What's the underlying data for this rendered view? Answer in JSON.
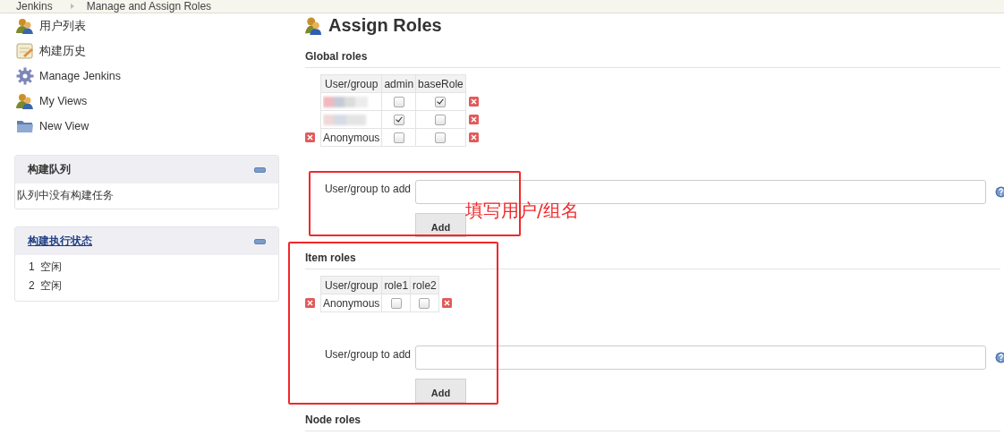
{
  "breadcrumb": [
    {
      "label": "Jenkins"
    },
    {
      "label": "Manage and Assign Roles"
    }
  ],
  "sidebar": {
    "tasks": [
      {
        "label": "用户列表"
      },
      {
        "label": "构建历史"
      },
      {
        "label": "Manage Jenkins"
      },
      {
        "label": "My Views"
      },
      {
        "label": "New View"
      }
    ],
    "build_queue": {
      "title": "构建队列",
      "expanded": true,
      "message": "队列中没有构建任务"
    },
    "executors": {
      "title": "构建执行状态",
      "expanded": true,
      "items": [
        {
          "number": "1",
          "status": "空闲"
        },
        {
          "number": "2",
          "status": "空闲"
        }
      ]
    }
  },
  "page": {
    "title": "Assign Roles",
    "sections": [
      {
        "title": "Global roles",
        "columns": [
          "User/group",
          "admin",
          "baseRole"
        ],
        "rows": [
          {
            "kind": "blurred",
            "checked": [
              false,
              true
            ]
          },
          {
            "kind": "blurred",
            "checked": [
              true,
              false
            ]
          },
          {
            "kind": "user",
            "user": "Anonymous",
            "checked": [
              false,
              false
            ]
          }
        ],
        "add_label": "User/group to add",
        "add_button": "Add"
      },
      {
        "title": "Item roles",
        "columns": [
          "User/group",
          "role1",
          "role2"
        ],
        "rows": [
          {
            "kind": "user",
            "user": "Anonymous",
            "checked": [
              false,
              false
            ]
          }
        ],
        "add_label": "User/group to add",
        "add_button": "Add"
      },
      {
        "title": "Node roles"
      }
    ]
  },
  "annotations": [
    {
      "kind": "box"
    },
    {
      "kind": "box"
    },
    {
      "kind": "note",
      "text": "填写用户/组名"
    }
  ]
}
